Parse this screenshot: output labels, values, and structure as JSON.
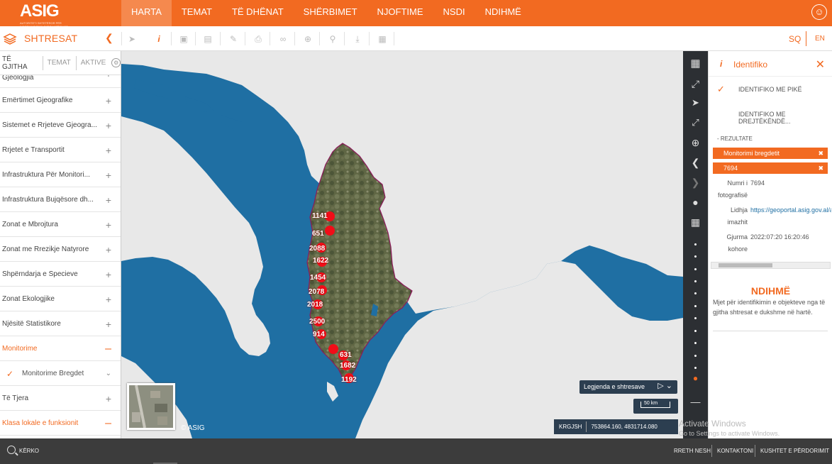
{
  "brand": {
    "logo_text": "ASIG",
    "logo_subtitle": "AUTORITETI SHTETËROR PËR INFORMACIONIN GJEOHAPËSINOR"
  },
  "nav": {
    "items": [
      "HARTA",
      "TEMAT",
      "TË DHËNAT",
      "SHËRBIMET",
      "NJOFTIME",
      "NSDI",
      "NDIHMË"
    ],
    "active": "HARTA"
  },
  "toolbar": {
    "panel_title": "SHTRESAT",
    "active_tool": "identify"
  },
  "language": {
    "sq": "SQ",
    "en": "EN"
  },
  "sidebar": {
    "tabs": [
      "TË GJITHA",
      "TEMAT",
      "AKTIVE"
    ],
    "layers": [
      {
        "label": "Gjeologjia",
        "state": "collapsed"
      },
      {
        "label": "Emërtimet Gjeografike",
        "state": "collapsed"
      },
      {
        "label": "Sistemet e Rrjeteve Gjeogra...",
        "state": "collapsed"
      },
      {
        "label": "Rrjetet e Transportit",
        "state": "collapsed"
      },
      {
        "label": "Infrastruktura Për Monitori...",
        "state": "collapsed"
      },
      {
        "label": "Infrastruktura Bujqësore dh...",
        "state": "collapsed"
      },
      {
        "label": "Zonat e Mbrojtura",
        "state": "collapsed"
      },
      {
        "label": "Zonat me Rrezikje Natyrore",
        "state": "collapsed"
      },
      {
        "label": "Shpërndarja e Specieve",
        "state": "collapsed"
      },
      {
        "label": "Zonat Ekologjike",
        "state": "collapsed"
      },
      {
        "label": "Njësitë Statistikore",
        "state": "collapsed"
      },
      {
        "label": "Monitorime",
        "state": "expanded"
      },
      {
        "label": "Monitorime Bregdet",
        "state": "sublayer-checked"
      },
      {
        "label": "Të Tjera",
        "state": "collapsed"
      },
      {
        "label": "Klasa lokale e funksionit",
        "state": "expanded"
      }
    ]
  },
  "map": {
    "points": [
      "1141",
      "651",
      "2088",
      "1622",
      "1454",
      "2078",
      "2018",
      "2500",
      "914",
      "631",
      "1682",
      "1192"
    ],
    "copyright": "© ASIG",
    "legend_label": "Legjenda e shtresave",
    "scale_label": "50 km",
    "crs": "KRGJSH",
    "coordinates": "753864.160, 4831714.080"
  },
  "identify": {
    "title": "Identifiko",
    "option_point": "IDENTIFIKO ME PIKË",
    "option_rect": "IDENTIFIKO ME DREJTËKËNDË...",
    "results_label": "- REZULTATE",
    "results": [
      "Monitorimi bregdetit",
      "7694"
    ],
    "fields": [
      {
        "key": "Numri i fotografisë",
        "value": "7694"
      },
      {
        "key": "Lidhja imazhit",
        "value": "https://geoportal.asig.gov.al/a"
      },
      {
        "key": "Gjurma kohore",
        "value": "2022:07:20 16:20:46"
      }
    ]
  },
  "help": {
    "title": "NDIHMË",
    "text": "Mjet për identifikimin e objekteve nga të gjitha shtresat e dukshme në hartë."
  },
  "watermark": {
    "title": "Activate Windows",
    "subtitle": "Go to Settings to activate Windows."
  },
  "footer": {
    "search_label": "KËRKO",
    "links": [
      "RRETH NESH",
      "KONTAKTONI",
      "KUSHTET E PËRDORIMIT"
    ]
  },
  "colors": {
    "accent": "#f26a21",
    "sea": "#1f6fa3",
    "land": "#e9e9e9",
    "footer": "#3c3c3c",
    "marker": "#f10d18"
  }
}
